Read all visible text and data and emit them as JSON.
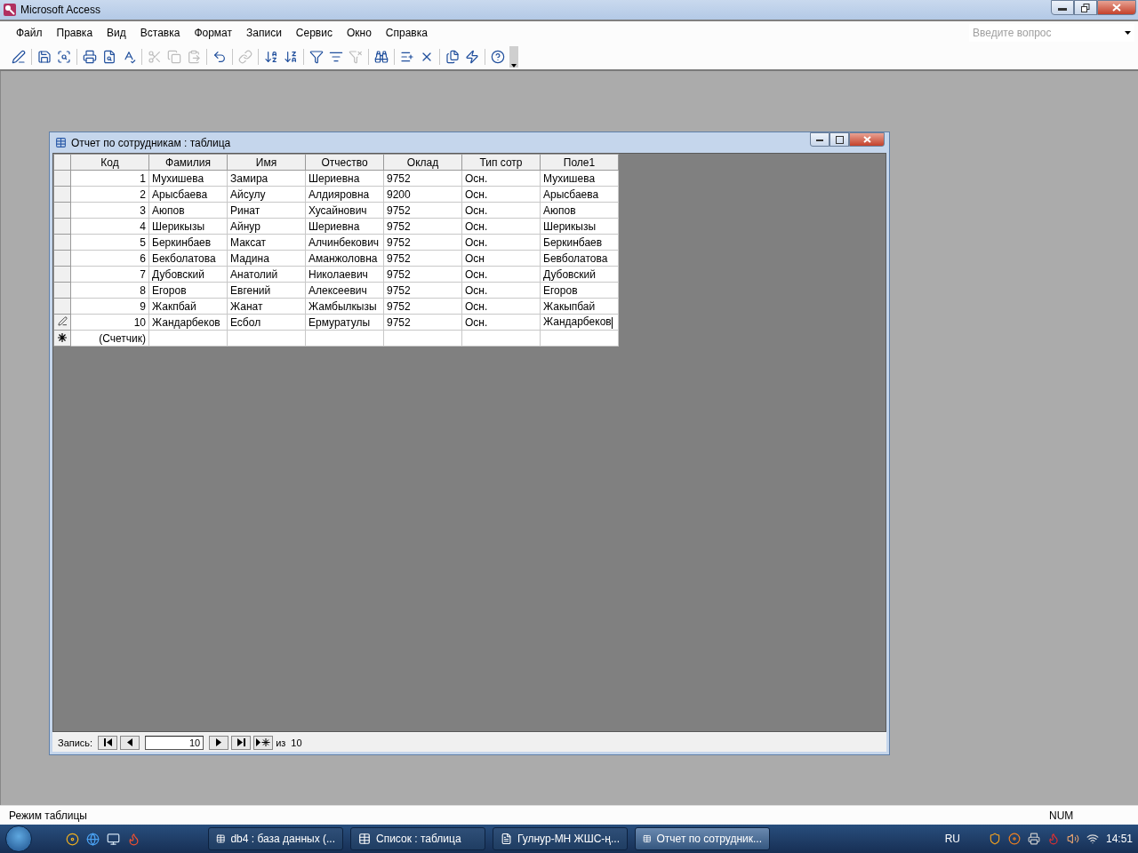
{
  "window": {
    "title": "Microsoft Access"
  },
  "menu": [
    {
      "label": "Файл"
    },
    {
      "label": "Правка"
    },
    {
      "label": "Вид"
    },
    {
      "label": "Вставка"
    },
    {
      "label": "Формат"
    },
    {
      "label": "Записи"
    },
    {
      "label": "Сервис"
    },
    {
      "label": "Окно"
    },
    {
      "label": "Справка"
    }
  ],
  "help_box": {
    "placeholder": "Введите вопрос"
  },
  "toolbar": [
    {
      "kind": "button",
      "disabled": false
    },
    {
      "kind": "separator"
    },
    {
      "kind": "button",
      "disabled": false
    },
    {
      "kind": "button",
      "disabled": false
    },
    {
      "kind": "separator"
    },
    {
      "kind": "button",
      "disabled": false
    },
    {
      "kind": "button",
      "disabled": false
    },
    {
      "kind": "button",
      "disabled": false
    },
    {
      "kind": "separator"
    },
    {
      "kind": "button",
      "disabled": true
    },
    {
      "kind": "button",
      "disabled": true
    },
    {
      "kind": "button",
      "disabled": true
    },
    {
      "kind": "separator"
    },
    {
      "kind": "button",
      "disabled": false
    },
    {
      "kind": "separator"
    },
    {
      "kind": "button",
      "disabled": true
    },
    {
      "kind": "separator"
    },
    {
      "kind": "button",
      "disabled": false
    },
    {
      "kind": "button",
      "disabled": false
    },
    {
      "kind": "separator"
    },
    {
      "kind": "button",
      "disabled": false
    },
    {
      "kind": "button",
      "disabled": false
    },
    {
      "kind": "button",
      "disabled": true
    },
    {
      "kind": "separator"
    },
    {
      "kind": "button",
      "disabled": false
    },
    {
      "kind": "separator"
    },
    {
      "kind": "button",
      "disabled": false
    },
    {
      "kind": "button",
      "disabled": false
    },
    {
      "kind": "separator"
    },
    {
      "kind": "button",
      "disabled": false
    },
    {
      "kind": "button",
      "disabled": false
    },
    {
      "kind": "separator"
    },
    {
      "kind": "button",
      "disabled": false
    }
  ],
  "child_window": {
    "title": "Отчет по сотрудникам : таблица"
  },
  "table": {
    "columns": [
      "Код",
      "Фамилия",
      "Имя",
      "Отчество",
      "Оклад",
      "Тип сотр",
      "Поле1"
    ],
    "rows": [
      {
        "kind": "record",
        "cells": [
          "1",
          "Мухишева",
          "Замира",
          "Шериевна",
          "9752",
          "Осн.",
          "Мухишева"
        ]
      },
      {
        "kind": "record",
        "cells": [
          "2",
          "Арысбаева",
          "Айсулу",
          "Алдияровна",
          "9200",
          "Осн.",
          "Арысбаева"
        ]
      },
      {
        "kind": "record",
        "cells": [
          "3",
          "Аюпов",
          "Ринат",
          "Хусайнович",
          "9752",
          "Осн.",
          "Аюпов"
        ]
      },
      {
        "kind": "record",
        "cells": [
          "4",
          "Шерикызы",
          "Айнур",
          "Шериевна",
          "9752",
          "Осн.",
          "Шерикызы"
        ]
      },
      {
        "kind": "record",
        "cells": [
          "5",
          "Беркинбаев",
          "Максат",
          "Алчинбекович",
          "9752",
          "Осн.",
          "Беркинбаев"
        ]
      },
      {
        "kind": "record",
        "cells": [
          "6",
          "Бекболатова",
          "Мадина",
          "Аманжоловна",
          "9752",
          "Осн",
          "Бевболатова"
        ]
      },
      {
        "kind": "record",
        "cells": [
          "7",
          "Дубовский",
          "Анатолий",
          "Николаевич",
          "9752",
          "Осн.",
          "Дубовский"
        ]
      },
      {
        "kind": "record",
        "cells": [
          "8",
          "Егоров",
          "Евгений",
          "Алексеевич",
          "9752",
          "Осн.",
          "Егоров"
        ]
      },
      {
        "kind": "record",
        "cells": [
          "9",
          "Жакпбай",
          "Жанат",
          "Жамбылкызы",
          "9752",
          "Осн.",
          "Жакыпбай"
        ]
      },
      {
        "kind": "editing",
        "cells": [
          "10",
          "Жандарбеков",
          "Есбол",
          "Ермуратулы",
          "9752",
          "Осн.",
          "Жандарбеков"
        ]
      },
      {
        "kind": "new",
        "cells": [
          "(Счетчик)",
          "",
          "",
          "",
          "",
          "",
          ""
        ]
      }
    ]
  },
  "navigator": {
    "label": "Запись:",
    "current": "10",
    "of_label": "из",
    "total": "10"
  },
  "status_bar": {
    "text": "Режим таблицы",
    "indicator": "NUM"
  },
  "taskbar": {
    "tasks": [
      {
        "label": "db4 : база данных (...",
        "selected": false
      },
      {
        "label": "Список : таблица",
        "selected": false
      },
      {
        "label": "Гулнур-МН ЖШС-ң...",
        "selected": false
      },
      {
        "label": "Отчет по сотрудник...",
        "selected": true
      }
    ],
    "language": "RU",
    "time": "14:51"
  }
}
